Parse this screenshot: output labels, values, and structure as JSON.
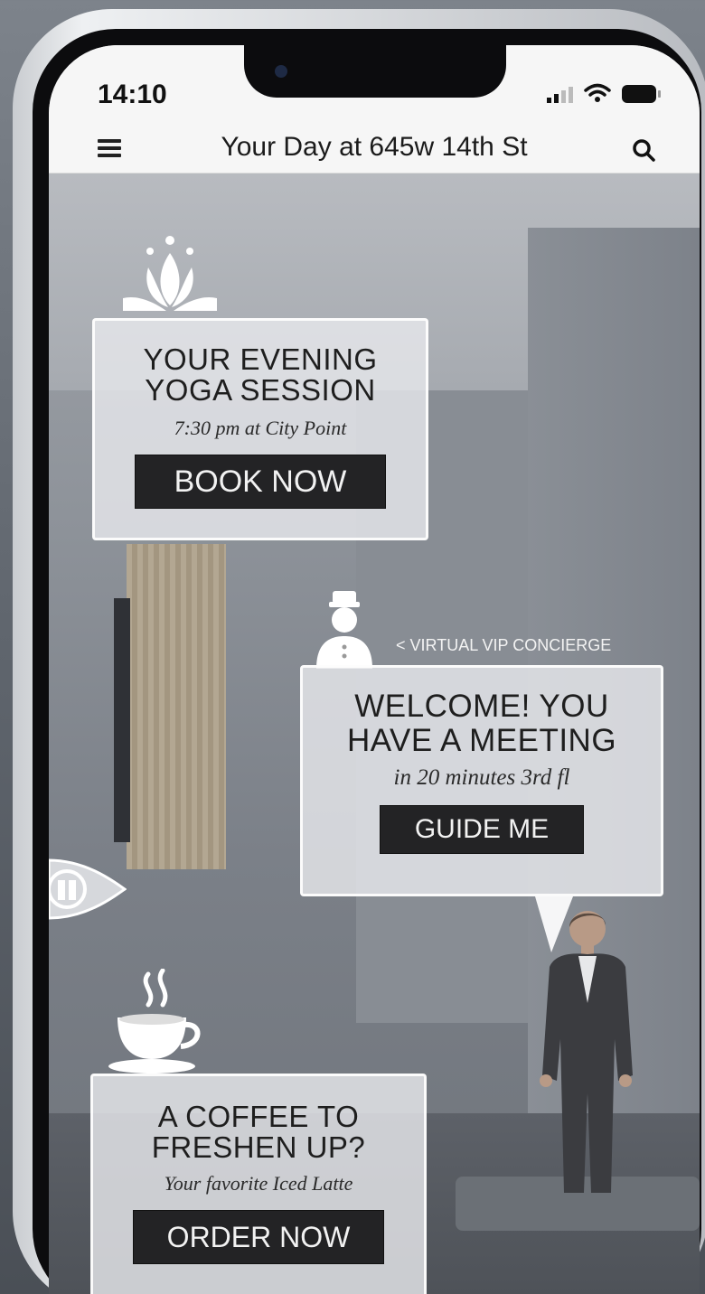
{
  "status_bar": {
    "time": "14:10"
  },
  "navbar": {
    "title": "Your Day at 645w 14th St"
  },
  "cards": {
    "yoga": {
      "heading_line1": "YOUR EVENING",
      "heading_line2": "YOGA SESSION",
      "subtitle": "7:30 pm at City Point",
      "button": "BOOK NOW"
    },
    "concierge": {
      "label": "< VIRTUAL VIP CONCIERGE",
      "heading_line1": "WELCOME! YOU",
      "heading_line2": "HAVE A MEETING",
      "subtitle": "in 20 minutes 3rd fl",
      "button": "GUIDE ME"
    },
    "coffee": {
      "heading_line1": "A COFFEE TO",
      "heading_line2": "FRESHEN UP?",
      "subtitle": "Your favorite Iced Latte",
      "button": "ORDER NOW"
    }
  },
  "icons": [
    "lotus-icon",
    "bellhop-icon",
    "eye-door-icon",
    "coffee-cup-icon",
    "menu-icon",
    "search-icon",
    "signal-icon",
    "wifi-icon",
    "battery-icon"
  ]
}
